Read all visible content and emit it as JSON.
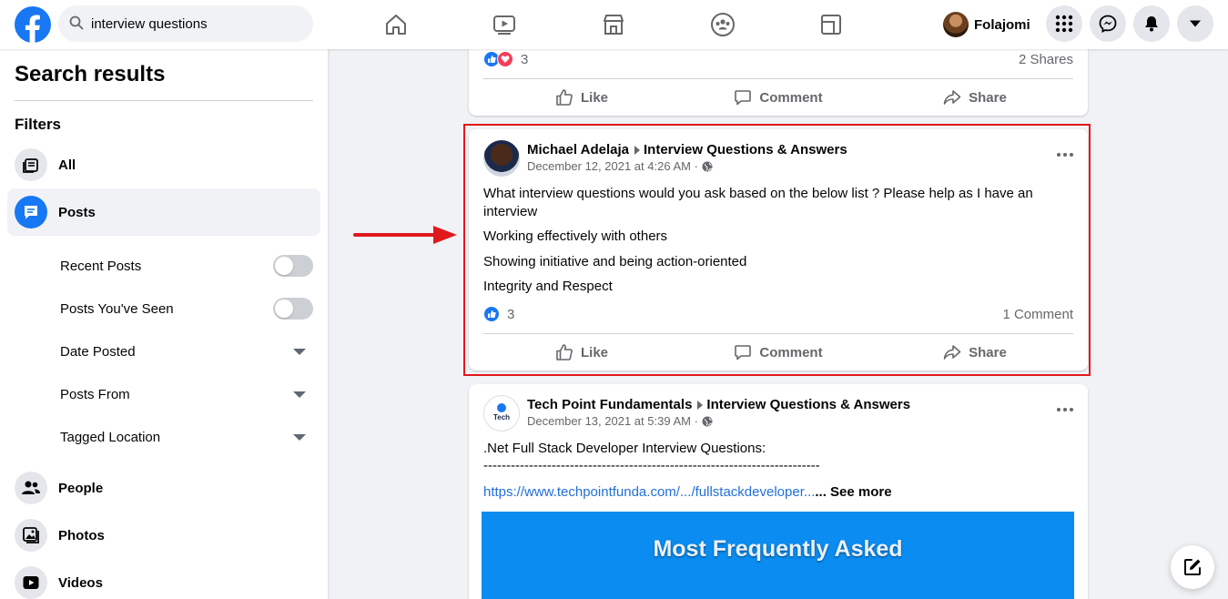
{
  "header": {
    "search_value": "interview questions",
    "user_name": "Folajomi"
  },
  "sidebar": {
    "title": "Search results",
    "filters_label": "Filters",
    "items": [
      {
        "label": "All"
      },
      {
        "label": "Posts"
      },
      {
        "label": "People"
      },
      {
        "label": "Photos"
      },
      {
        "label": "Videos"
      }
    ],
    "post_filters": [
      {
        "label": "Recent Posts",
        "control": "toggle",
        "on": false
      },
      {
        "label": "Posts You've Seen",
        "control": "toggle",
        "on": false
      },
      {
        "label": "Date Posted",
        "control": "dropdown"
      },
      {
        "label": "Posts From",
        "control": "dropdown"
      },
      {
        "label": "Tagged Location",
        "control": "dropdown"
      }
    ]
  },
  "feed": {
    "actions": {
      "like": "Like",
      "comment": "Comment",
      "share": "Share"
    },
    "prev_post": {
      "reactions": "3",
      "shares": "2 Shares"
    },
    "post1": {
      "author": "Michael Adelaja",
      "group": "Interview Questions & Answers",
      "date": "December 12, 2021 at 4:26 AM",
      "text_lines": [
        "What interview questions would you ask based on the below list ? Please help as I have an interview",
        "Working effectively with others",
        "Showing initiative and being action-oriented",
        "Integrity and Respect"
      ],
      "reactions": "3",
      "comments": "1 Comment"
    },
    "post2": {
      "author": "Tech Point Fundamentals",
      "group": "Interview Questions & Answers",
      "date": "December 13, 2021 at 5:39 AM",
      "text_line": ".Net Full Stack Developer Interview Questions:",
      "dashes": "--------------------------------------------------------------------------",
      "link": "https://www.techpointfunda.com/.../fullstackdeveloper...",
      "link_suffix": "... See more",
      "image_text": "Most Frequently Asked",
      "logo_text": "Tech"
    }
  },
  "colors": {
    "brand": "#1877f2",
    "highlight": "#e0191d"
  }
}
